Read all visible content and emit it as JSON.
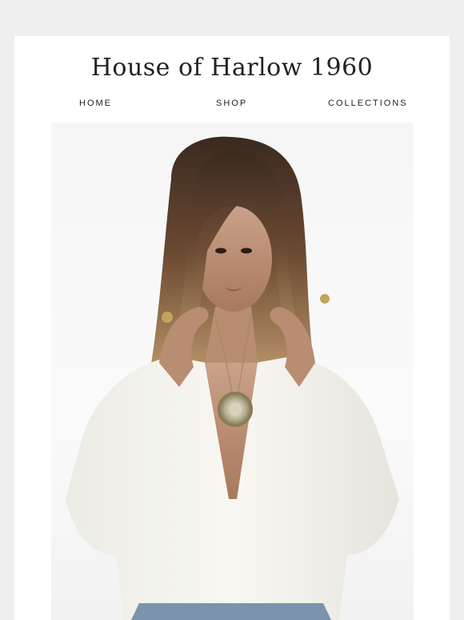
{
  "header": {
    "brand": "House of Harlow 1960"
  },
  "nav": {
    "items": [
      {
        "label": "HOME"
      },
      {
        "label": "SHOP"
      },
      {
        "label": "COLLECTIONS"
      }
    ]
  },
  "hero": {
    "image": "fashion-model-photo"
  },
  "colors": {
    "page_background": "#efefef",
    "card_background": "#ffffff",
    "text": "#222222"
  }
}
